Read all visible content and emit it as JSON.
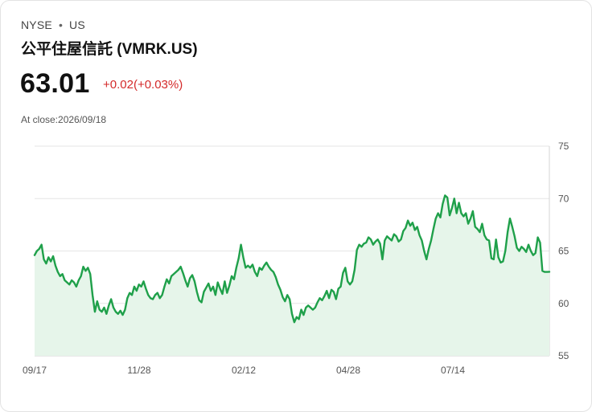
{
  "header": {
    "exchange": "NYSE",
    "separator": "•",
    "region": "US",
    "title": "公平住屋信託 (VMRK.US)",
    "price": "63.01",
    "change": "+0.02(+0.03%)",
    "close_label": "At close:",
    "close_date": "2026/09/18"
  },
  "colors": {
    "line": "#1fa04a",
    "fill": "#e6f5ea",
    "change_negative_up": "#d42a2a",
    "grid": "#e6e6e6"
  },
  "chart_data": {
    "type": "area",
    "title": "",
    "xlabel": "",
    "ylabel": "",
    "ylim": [
      55,
      75
    ],
    "y_ticks": [
      "55",
      "60",
      "65",
      "70",
      "75"
    ],
    "x_tick_labels": [
      "09/17",
      "11/28",
      "02/12",
      "04/28",
      "07/14"
    ],
    "grid": true,
    "values": [
      64.6,
      65.0,
      65.2,
      65.6,
      64.2,
      63.8,
      64.4,
      64.0,
      64.5,
      63.6,
      63.0,
      62.6,
      62.8,
      62.2,
      62.0,
      61.8,
      62.2,
      62.0,
      61.6,
      62.2,
      62.6,
      63.5,
      63.1,
      63.4,
      62.8,
      60.8,
      59.2,
      60.2,
      59.4,
      59.2,
      59.6,
      59.0,
      59.8,
      60.4,
      59.6,
      59.2,
      59.0,
      59.3,
      58.9,
      59.4,
      60.5,
      61.0,
      60.8,
      61.6,
      61.2,
      61.8,
      61.6,
      62.1,
      61.4,
      60.8,
      60.5,
      60.4,
      60.8,
      61.0,
      60.5,
      60.8,
      61.6,
      62.3,
      61.9,
      62.6,
      62.8,
      63.0,
      63.2,
      63.5,
      62.9,
      62.2,
      61.6,
      62.4,
      62.7,
      62.1,
      61.1,
      60.3,
      60.1,
      61.1,
      61.5,
      61.9,
      61.2,
      61.6,
      60.8,
      62.0,
      61.4,
      60.9,
      62.1,
      61.0,
      61.7,
      62.6,
      62.3,
      63.4,
      64.3,
      65.6,
      64.4,
      63.4,
      63.6,
      63.4,
      63.7,
      63.0,
      62.6,
      63.4,
      63.2,
      63.6,
      63.9,
      63.5,
      63.2,
      63.0,
      62.5,
      61.8,
      61.3,
      60.6,
      60.2,
      60.8,
      60.4,
      59.0,
      58.2,
      58.7,
      58.5,
      59.4,
      58.9,
      59.6,
      59.8,
      59.6,
      59.4,
      59.6,
      60.1,
      60.5,
      60.3,
      60.7,
      61.2,
      60.5,
      61.3,
      61.1,
      60.4,
      61.4,
      61.6,
      62.9,
      63.4,
      62.1,
      61.8,
      62.1,
      63.2,
      65.1,
      65.6,
      65.4,
      65.7,
      65.8,
      66.3,
      66.1,
      65.6,
      65.9,
      66.1,
      65.7,
      64.2,
      66.0,
      66.4,
      66.2,
      66.0,
      66.6,
      66.4,
      65.9,
      66.1,
      66.9,
      67.2,
      67.9,
      67.4,
      67.7,
      67.0,
      67.3,
      66.5,
      66.0,
      65.0,
      64.2,
      65.2,
      66.0,
      67.1,
      68.1,
      68.6,
      68.2,
      69.5,
      70.3,
      70.1,
      68.4,
      69.1,
      70.0,
      68.6,
      69.6,
      68.6,
      68.3,
      68.6,
      67.6,
      68.1,
      68.8,
      67.3,
      67.1,
      66.8,
      67.6,
      66.5,
      66.1,
      66.0,
      64.3,
      64.2,
      66.1,
      64.4,
      63.9,
      64.0,
      65.0,
      66.8,
      68.1,
      67.3,
      66.4,
      65.3,
      65.0,
      65.4,
      65.2,
      64.9,
      65.6,
      65.0,
      64.6,
      64.8,
      66.3,
      65.8,
      63.1,
      63.0,
      63.0,
      63.01
    ]
  }
}
